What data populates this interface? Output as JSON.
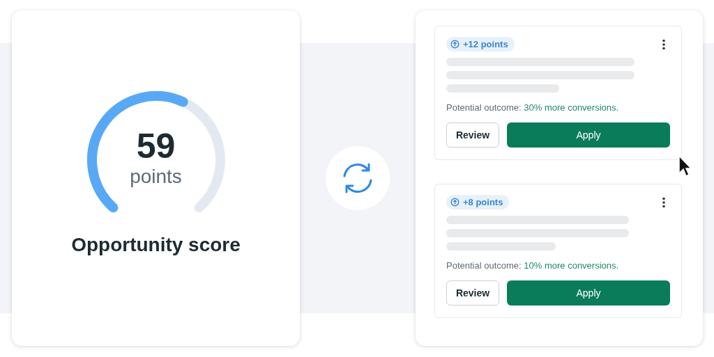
{
  "score": {
    "value": "59",
    "unit": "points",
    "label": "Opportunity score"
  },
  "recommendations": [
    {
      "badge": "+12 points",
      "outcome_label": "Potential outcome:",
      "outcome_value": "30% more conversions.",
      "buttons": [
        "Review",
        "Apply"
      ]
    },
    {
      "badge": "+8 points",
      "outcome_label": "Potential outcome:",
      "outcome_value": "10% more conversions.",
      "buttons": [
        "Review",
        "Apply"
      ]
    }
  ]
}
